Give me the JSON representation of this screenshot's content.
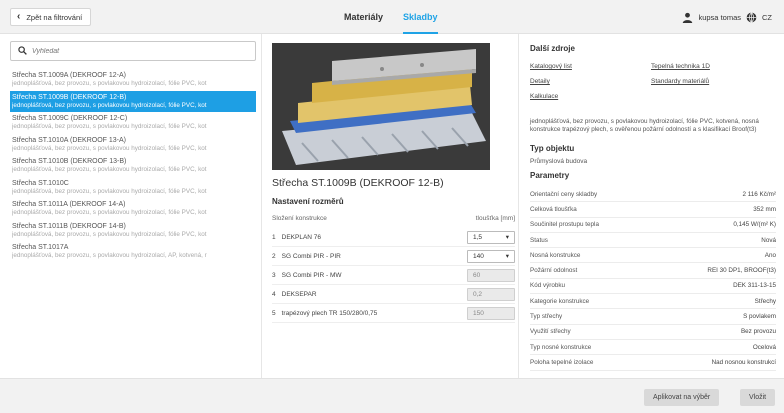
{
  "header": {
    "back_label": "Zpět na filtrování",
    "tabs": [
      {
        "label": "Materiály",
        "active": false
      },
      {
        "label": "Skladby",
        "active": true
      }
    ],
    "user_name": "kupsa tomas",
    "language": "CZ",
    "accent_color": "#1fa3e6"
  },
  "search": {
    "placeholder": "Vyhledat"
  },
  "list": [
    {
      "title": "Střecha ST.1009A (DEKROOF 12-A)",
      "desc": "jednoplášťová, bez provozu, s povlakovou hydroizolací, fólie PVC, kot"
    },
    {
      "title": "Střecha ST.1009B (DEKROOF 12-B)",
      "desc": "jednoplášťová, bez provozu, s povlakovou hydroizolací, fólie PVC, kot",
      "selected": true
    },
    {
      "title": "Střecha ST.1009C (DEKROOF 12-C)",
      "desc": "jednoplášťová, bez provozu, s povlakovou hydroizolací, fólie PVC, kot"
    },
    {
      "title": "Střecha ST.1010A (DEKROOF 13-A)",
      "desc": "jednoplášťová, bez provozu, s povlakovou hydroizolací, fólie PVC, kot"
    },
    {
      "title": "Střecha ST.1010B (DEKROOF 13-B)",
      "desc": "jednoplášťová, bez provozu, s povlakovou hydroizolací, fólie PVC, kot"
    },
    {
      "title": "Střecha ST.1010C",
      "desc": "jednoplášťová, bez provozu, s povlakovou hydroizolací, fólie PVC, kot"
    },
    {
      "title": "Střecha ST.1011A (DEKROOF 14-A)",
      "desc": "jednoplášťová, bez provozu, s povlakovou hydroizolací, fólie PVC, kot"
    },
    {
      "title": "Střecha ST.1011B (DEKROOF 14-B)",
      "desc": "jednoplášťová, bez provozu, s povlakovou hydroizolací, fólie PVC, kot"
    },
    {
      "title": "Střecha ST.1017A",
      "desc": "jednoplášťová, bez provozu, s povlakovou hydroizolací, AP, kotvená, r"
    }
  ],
  "detail": {
    "title": "Střecha ST.1009B (DEKROOF 12-B)",
    "settings_title": "Nastavení rozměrů",
    "col_composition": "Složení konstrukce",
    "col_thickness": "tloušťka [mm]",
    "layers": [
      {
        "num": "1",
        "name": "DEKPLAN 76",
        "value": "1,5",
        "dropdown": true
      },
      {
        "num": "2",
        "name": "SG Combi PIR - PIR",
        "value": "140",
        "dropdown": true
      },
      {
        "num": "3",
        "name": "SG Combi PIR - MW",
        "value": "60",
        "dropdown": false
      },
      {
        "num": "4",
        "name": "DEKSEPAR",
        "value": "0,2",
        "dropdown": false
      },
      {
        "num": "5",
        "name": "trapézový plech TR 150/280/0,75",
        "value": "150",
        "dropdown": false
      }
    ]
  },
  "right": {
    "resources_title": "Další zdroje",
    "links": {
      "catalog": "Katalogový list",
      "thermal": "Tepelná technika 1D",
      "details": "Detaily",
      "standards": "Standardy materiálů",
      "calc": "Kalkulace"
    },
    "description": "jednoplášťová, bez provozu, s povlakovou hydroizolací, fólie PVC, kotvená, nosná konstrukce trapézový plech, s ověřenou požární odolností a s klasifikací Broof(t3)",
    "object_type_title": "Typ objektu",
    "object_type": "Průmyslová budova",
    "params_title": "Parametry",
    "params": [
      {
        "label": "Orientační ceny skladby",
        "value": "2 116 Kč/m²"
      },
      {
        "label": "Celková tloušťka",
        "value": "352 mm"
      },
      {
        "label": "Součinitel prostupu tepla",
        "value": "0,145 W/(m² K)"
      },
      {
        "label": "Status",
        "value": "Nová"
      },
      {
        "label": "Nosná konstrukce",
        "value": "Ano"
      },
      {
        "label": "Požární odolnost",
        "value": "REI 30 DP1, BROOF(t3)"
      },
      {
        "label": "Kód výrobku",
        "value": "DEK 311-13-15"
      },
      {
        "label": "Kategorie konstrukce",
        "value": "Střechy"
      },
      {
        "label": "Typ střechy",
        "value": "S povlakem"
      },
      {
        "label": "Využití střechy",
        "value": "Bez provozu"
      },
      {
        "label": "Typ nosné konstrukce",
        "value": "Ocelová"
      },
      {
        "label": "Poloha tepelné izolace",
        "value": "Nad nosnou konstrukcí"
      }
    ]
  },
  "footer": {
    "apply_label": "Aplikovat na výběr",
    "close_label": "Vložit"
  }
}
